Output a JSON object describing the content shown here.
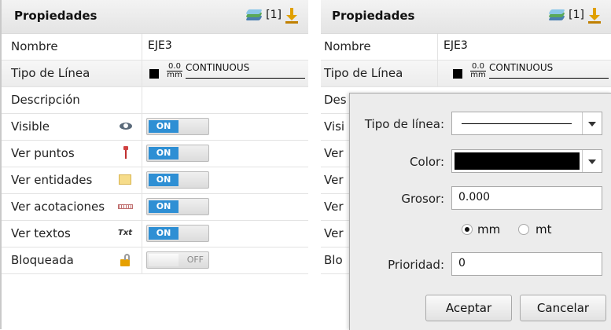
{
  "left_panel": {
    "title": "Propiedades",
    "layer_count": "[1]",
    "rows": {
      "nombre": {
        "label": "Nombre",
        "value": "EJE3"
      },
      "tipo_linea": {
        "label": "Tipo de Línea",
        "thickness": "0.0",
        "unit": "mm",
        "linetype": "CONTINUOUS"
      },
      "descripcion": {
        "label": "Descripción"
      },
      "visible": {
        "label": "Visible",
        "state": "ON"
      },
      "ver_puntos": {
        "label": "Ver puntos",
        "state": "ON"
      },
      "ver_entidades": {
        "label": "Ver entidades",
        "state": "ON"
      },
      "ver_acotaciones": {
        "label": "Ver acotaciones",
        "state": "ON"
      },
      "ver_textos": {
        "label": "Ver textos",
        "state": "ON",
        "icon_text": "Txt"
      },
      "bloqueada": {
        "label": "Bloqueada",
        "state": "OFF"
      }
    }
  },
  "right_panel": {
    "title": "Propiedades",
    "layer_count": "[1]",
    "rows": {
      "nombre": {
        "label": "Nombre",
        "value": "EJE3"
      },
      "tipo_linea": {
        "label": "Tipo de Línea",
        "thickness": "0.0",
        "unit": "mm",
        "linetype": "CONTINUOUS"
      },
      "r3": "Des",
      "r4": "Visi",
      "r5": "Ver",
      "r6": "Ver",
      "r7": "Ver",
      "r8": "Ver",
      "r9": "Blo"
    }
  },
  "dialog": {
    "tipo_linea_label": "Tipo de línea:",
    "color_label": "Color:",
    "color_value": "#000000",
    "grosor_label": "Grosor:",
    "grosor_value": "0.000",
    "unit_options": [
      {
        "label": "mm",
        "selected": true
      },
      {
        "label": "mt",
        "selected": false
      }
    ],
    "prioridad_label": "Prioridad:",
    "prioridad_value": "0",
    "accept_button": "Aceptar",
    "cancel_button": "Cancelar"
  },
  "icons": [
    "layers-icon",
    "download-icon",
    "eye-icon",
    "pin-icon",
    "sticky-note-icon",
    "ruler-icon",
    "text-icon",
    "lock-icon"
  ],
  "colors": {
    "toggle_on": "#2e8fd4",
    "header_bg": "#e9e9e9",
    "dialog_bg": "#ececec"
  }
}
